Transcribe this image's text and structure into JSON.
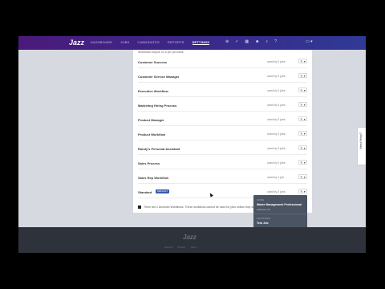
{
  "nav": {
    "logo": "Jazz",
    "links": [
      "DASHBOARD",
      "JOBS",
      "CANDIDATES",
      "REPORTS",
      "SETTINGS"
    ],
    "active": "SETTINGS",
    "icons": [
      "person-add-icon",
      "check-icon",
      "calendar-icon",
      "users-icon",
      "search-icon",
      "help-icon",
      "account-icon"
    ]
  },
  "panel": {
    "intro": "Workflows require on a per job basis.",
    "rows": [
      {
        "name": "Customer Success",
        "used": "used by 0 jobs",
        "edit_label": "✎ ▾"
      },
      {
        "name": "Customer Service Manager",
        "used": "used by 0 jobs",
        "edit_label": "✎ ▾"
      },
      {
        "name": "Executive Workflow",
        "used": "used by 0 jobs",
        "edit_label": "✎ ▾"
      },
      {
        "name": "Marketing Hiring Process",
        "used": "used by 0 jobs",
        "edit_label": "✎ ▾"
      },
      {
        "name": "Product Manager",
        "used": "used by 0 jobs",
        "edit_label": "✎ ▾"
      },
      {
        "name": "Product Workflow",
        "used": "used by 0 jobs",
        "edit_label": "✎ ▾"
      },
      {
        "name": "Randy's Personal Assistant",
        "used": "used by 0 jobs",
        "edit_label": "✎ ▾"
      },
      {
        "name": "Sales Process",
        "used": "used by 0 jobs",
        "edit_label": "✎ ▾"
      },
      {
        "name": "Sales Rep Workflow",
        "used": "used by 1 job",
        "edit_label": "✎ ▾"
      },
      {
        "name": "Standard",
        "used": "used by 2 jobs",
        "edit_label": "✎ ▾",
        "badge": "DEFAULT"
      }
    ],
    "notice": "There are 2 Archived Workflows. These workflows cannot be used for jobs unless they are restored."
  },
  "tooltip": {
    "section1": "OPEN",
    "job1": "Waste Management Professional",
    "job1_sub": "Fairview, CA",
    "section2": "ARCHIVED",
    "job2": "Test Job",
    "job2_sub": "Lorem ipsum"
  },
  "feedback": "Need Help?",
  "footer": {
    "logo": "Jazz",
    "links": [
      "Support",
      "Privacy",
      "Terms"
    ]
  }
}
